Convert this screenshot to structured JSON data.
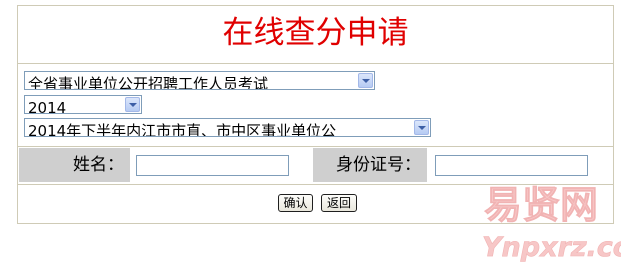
{
  "page": {
    "title": "在线查分申请"
  },
  "selects": {
    "category": "全省事业单位公开招聘工作人员考试",
    "year": "2014",
    "exam": "2014年下半年内江市市直、市中区事业单位公"
  },
  "form": {
    "name_label": "姓名：",
    "name_value": "",
    "id_label": "身份证号：",
    "id_value": ""
  },
  "buttons": {
    "confirm": "确认",
    "back": "返回"
  },
  "watermark": {
    "brand": "易贤网",
    "domain": "Ynpxrz.com",
    "color": "#f7c7c7"
  }
}
